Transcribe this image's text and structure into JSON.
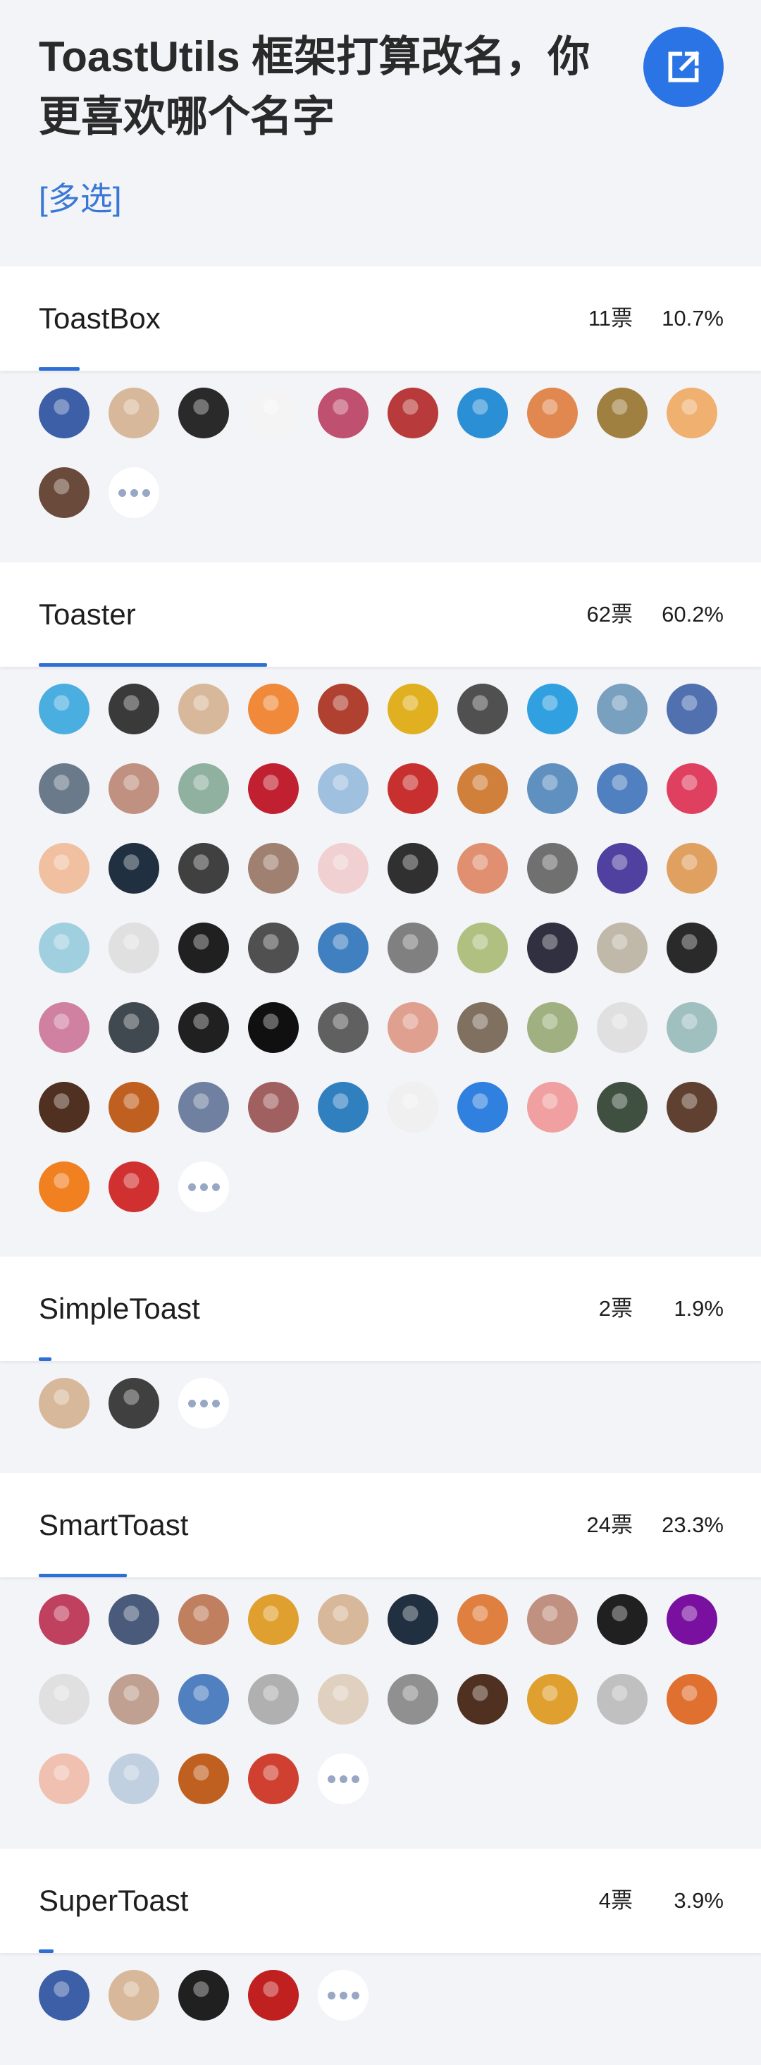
{
  "poll": {
    "title": "ToastUtils 框架打算改名，你更喜欢哪个名字",
    "mode": "[多选]",
    "share_icon": "external-link-icon"
  },
  "options": [
    {
      "name": "ToastBox",
      "votes": "11票",
      "percent": "10.7%",
      "fraction": 0.107,
      "avatar_colors": [
        "#3d5fa8",
        "#d8b89a",
        "#2a2a2a",
        "#f4f4f4",
        "#c05070",
        "#b83a3a",
        "#2b8fd6",
        "#e08850",
        "#a08040",
        "#f0b070",
        "#6a4a3a"
      ]
    },
    {
      "name": "Toaster",
      "votes": "62票",
      "percent": "60.2%",
      "fraction": 0.602,
      "avatar_colors": [
        "#4aaee0",
        "#3a3a3a",
        "#d8b89a",
        "#f08a3a",
        "#b04030",
        "#e0b020",
        "#505050",
        "#30a0e0",
        "#7aa0c0",
        "#5070b0",
        "#6a7a8a",
        "#c09080",
        "#90b0a0",
        "#c02030",
        "#a0c0e0",
        "#c83030",
        "#d0803a",
        "#6090c0",
        "#5080c0",
        "#e04060",
        "#f0c0a0",
        "#203040",
        "#404040",
        "#a08070",
        "#f0d0d0",
        "#303030",
        "#e09070",
        "#707070",
        "#5040a0",
        "#e0a060",
        "#a0d0e0",
        "#e0e0e0",
        "#202020",
        "#505050",
        "#4080c0",
        "#808080",
        "#b0c080",
        "#303040",
        "#c0b8a8",
        "#2a2a2a",
        "#d080a0",
        "#404850",
        "#202020",
        "#101010",
        "#606060",
        "#e0a090",
        "#807060",
        "#a0b080",
        "#e0e0e0",
        "#a0c0c0",
        "#503020",
        "#c06020",
        "#7080a0",
        "#a06060",
        "#3080c0",
        "#f0f0f0",
        "#3080e0",
        "#f0a0a0",
        "#405040",
        "#604030",
        "#f08020",
        "#d03030"
      ]
    },
    {
      "name": "SimpleToast",
      "votes": "2票",
      "percent": "1.9%",
      "fraction": 0.019,
      "avatar_colors": [
        "#d8b89a",
        "#404040"
      ]
    },
    {
      "name": "SmartToast",
      "votes": "24票",
      "percent": "23.3%",
      "fraction": 0.233,
      "avatar_colors": [
        "#c04060",
        "#4a5a7a",
        "#c08060",
        "#e0a030",
        "#d8b89a",
        "#203040",
        "#e08040",
        "#c09080",
        "#202020",
        "#7a10a0",
        "#e0e0e0",
        "#c0a090",
        "#5080c0",
        "#b0b0b0",
        "#e0d0c0",
        "#909090",
        "#503020",
        "#e0a030",
        "#c0c0c0",
        "#e07030",
        "#f0c0b0",
        "#c0d0e0",
        "#c06020",
        "#d04030"
      ]
    },
    {
      "name": "SuperToast",
      "votes": "4票",
      "percent": "3.9%",
      "fraction": 0.039,
      "avatar_colors": [
        "#3d5fa8",
        "#d8b89a",
        "#202020",
        "#c02020"
      ]
    }
  ]
}
